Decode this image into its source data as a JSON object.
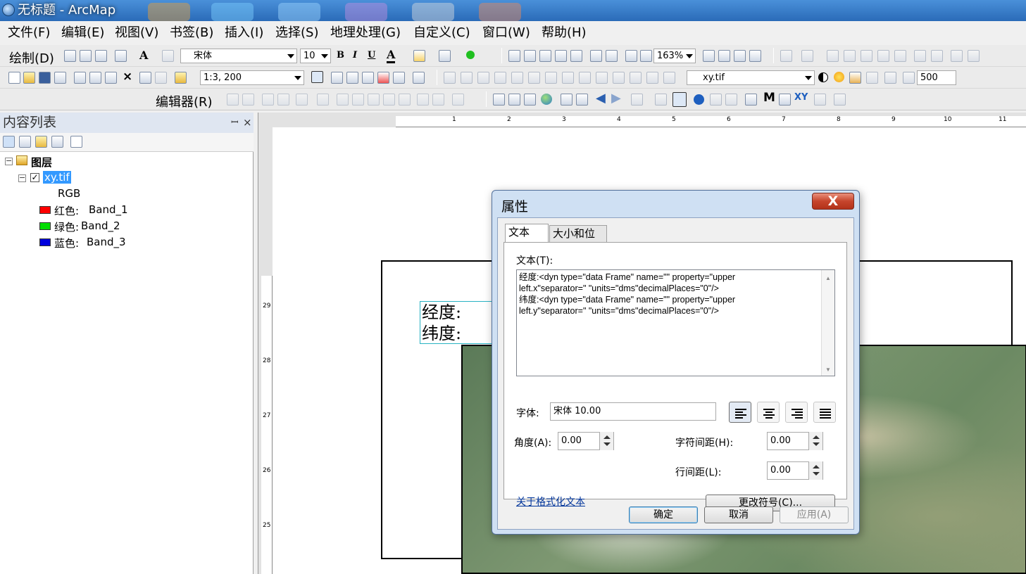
{
  "window": {
    "title": "无标题 - ArcMap"
  },
  "menu": [
    "文件(F)",
    "编辑(E)",
    "视图(V)",
    "书签(B)",
    "插入(I)",
    "选择(S)",
    "地理处理(G)",
    "自定义(C)",
    "窗口(W)",
    "帮助(H)"
  ],
  "draw_toolbar": {
    "draw_label": "绘制(D)",
    "font_name": "宋体",
    "font_size": "10",
    "bold": "B",
    "italic": "I",
    "underline": "U",
    "zoom_level": "163%"
  },
  "standard_toolbar": {
    "scale": "1:3, 200",
    "layer": "xy.tif",
    "transparency": "500"
  },
  "editor_toolbar": {
    "editor_label": "编辑器(R)"
  },
  "toc": {
    "title": "内容列表",
    "root_label": "图层",
    "layer_name": "xy.tif",
    "renderer": "RGB",
    "bands": [
      {
        "label": "红色:",
        "band": "Band_1",
        "color": "#ff0000"
      },
      {
        "label": "绿色:",
        "band": "Band_2",
        "color": "#00dd00"
      },
      {
        "label": "蓝色:",
        "band": "Band_3",
        "color": "#0000dd"
      }
    ]
  },
  "layout": {
    "text_line1": "经度:",
    "text_line2": "纬度:",
    "ruler_top": [
      "1",
      "2",
      "3",
      "4",
      "5",
      "6",
      "7",
      "8",
      "9",
      "10",
      "11"
    ],
    "ruler_left": [
      "29",
      "28",
      "27",
      "26",
      "25"
    ]
  },
  "dialog": {
    "title": "属性",
    "close_label": "X",
    "tabs": [
      "文本",
      "大小和位置"
    ],
    "text_label": "文本(T):",
    "text_lines": [
      "经度:<dyn type=\"data Frame\" name=\"\" property=\"upper",
      "left.x\"separator=\" \"units=\"dms\"decimalPlaces=\"0\"/>",
      "纬度:<dyn type=\"data Frame\" name=\"\" property=\"upper",
      "left.y\"separator=\" \"units=\"dms\"decimalPlaces=\"0\"/>"
    ],
    "font_label": "字体:",
    "font_value": "宋体 10.00",
    "angle_label": "角度(A):",
    "angle_value": "0.00",
    "char_spacing_label": "字符间距(H):",
    "char_spacing_value": "0.00",
    "line_spacing_label": "行间距(L):",
    "line_spacing_value": "0.00",
    "format_link": "关于格式化文本",
    "change_symbol": "更改符号(C)...",
    "ok": "确定",
    "cancel": "取消",
    "apply": "应用(A)"
  }
}
